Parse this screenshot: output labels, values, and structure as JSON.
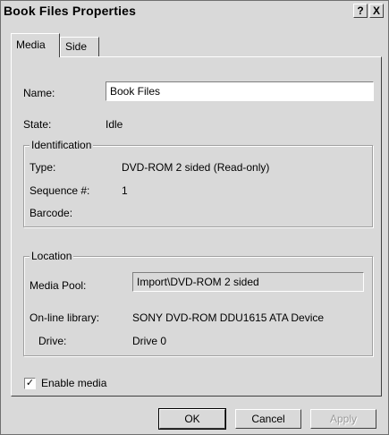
{
  "window": {
    "title": "Book Files Properties",
    "help_label": "?",
    "close_label": "X"
  },
  "tabs": [
    {
      "label": "Media",
      "active": true
    },
    {
      "label": "Side",
      "active": false
    }
  ],
  "general": {
    "name_label": "Name:",
    "name_value": "Book Files",
    "state_label": "State:",
    "state_value": "Idle"
  },
  "identification": {
    "legend": "Identification",
    "type_label": "Type:",
    "type_value": "DVD-ROM 2 sided (Read-only)",
    "sequence_label": "Sequence #:",
    "sequence_value": "1",
    "barcode_label": "Barcode:",
    "barcode_value": ""
  },
  "location": {
    "legend": "Location",
    "media_pool_label": "Media Pool:",
    "media_pool_value": "Import\\DVD-ROM 2 sided",
    "online_library_label": "On-line library:",
    "online_library_value": "SONY DVD-ROM DDU1615 ATA Device",
    "drive_label": "Drive:",
    "drive_value": "Drive 0"
  },
  "enable_media": {
    "label": "Enable media",
    "checked": true,
    "check_glyph": "✓"
  },
  "buttons": {
    "ok": "OK",
    "cancel": "Cancel",
    "apply": "Apply"
  }
}
